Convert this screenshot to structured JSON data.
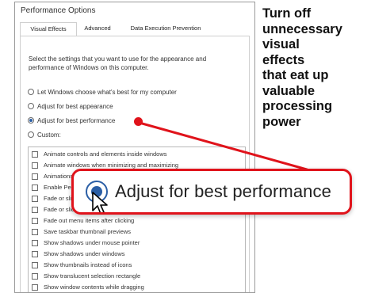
{
  "dialog": {
    "title": "Performance Options",
    "tabs": [
      {
        "label": "Visual Effects",
        "active": true
      },
      {
        "label": "Advanced",
        "active": false
      },
      {
        "label": "Data Execution Prevention",
        "active": false
      }
    ],
    "intro": "Select the settings that you want to use for the appearance and performance of Windows on this computer.",
    "radios": [
      {
        "label": "Let Windows choose what's best for my computer",
        "checked": false
      },
      {
        "label": "Adjust for best appearance",
        "checked": false
      },
      {
        "label": "Adjust for best performance",
        "checked": true
      },
      {
        "label": "Custom:",
        "checked": false
      }
    ],
    "checkboxes": [
      "Animate controls and elements inside windows",
      "Animate windows when minimizing and maximizing",
      "Animations in the taskbar",
      "Enable Peek",
      "Fade or slide menus into view",
      "Fade or slide ToolTips into view",
      "Fade out menu items after clicking",
      "Save taskbar thumbnail previews",
      "Show shadows under mouse pointer",
      "Show shadows under windows",
      "Show thumbnails instead of icons",
      "Show translucent selection rectangle",
      "Show window contents while dragging"
    ]
  },
  "callout": "Turn off\nunnecessary\nvisual\neffects\nthat eat up\nvaluable\nprocessing\npower",
  "zoom": {
    "label": "Adjust for best performance"
  },
  "colors": {
    "accent_red": "#e0131b",
    "radio_blue": "#2a5ea5"
  }
}
